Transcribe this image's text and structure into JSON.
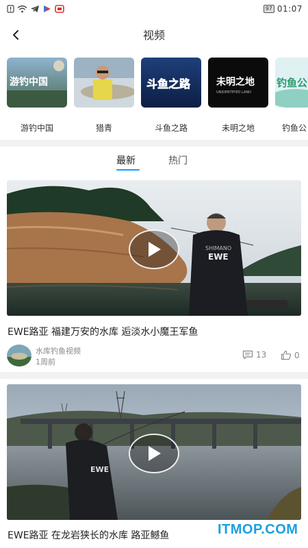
{
  "status_bar": {
    "battery": "97",
    "time": "01:07"
  },
  "nav": {
    "title": "视频"
  },
  "channels": [
    {
      "name": "游钓中国",
      "thumb_text": "游钓中国"
    },
    {
      "name": "猎青",
      "thumb_text": ""
    },
    {
      "name": "斗鱼之路",
      "thumb_text": "斗鱼之路"
    },
    {
      "name": "未明之地",
      "thumb_text": "未明之地",
      "thumb_subtext": "UNIDENTIFIED LAND"
    },
    {
      "name": "钓鱼公",
      "thumb_text": "钓鱼公"
    }
  ],
  "tabs": {
    "latest": "最新",
    "hot": "热门"
  },
  "videos": [
    {
      "title": "EWE路亚 福建万安的水库 逅淡水小魔王军鱼",
      "author": "水库钓鱼视频",
      "time": "1周前",
      "comments": "13",
      "likes": "0",
      "jacket_brand": "EWE"
    },
    {
      "title": "EWE路亚 在龙岩狭长的水库 路亚鳡鱼",
      "jacket_brand": "EWE"
    }
  ],
  "watermark": "ITMOP.COM",
  "colors": {
    "accent": "#1b9bf0",
    "watermark": "#1aa0e0",
    "divider": "#f2f2f4"
  }
}
